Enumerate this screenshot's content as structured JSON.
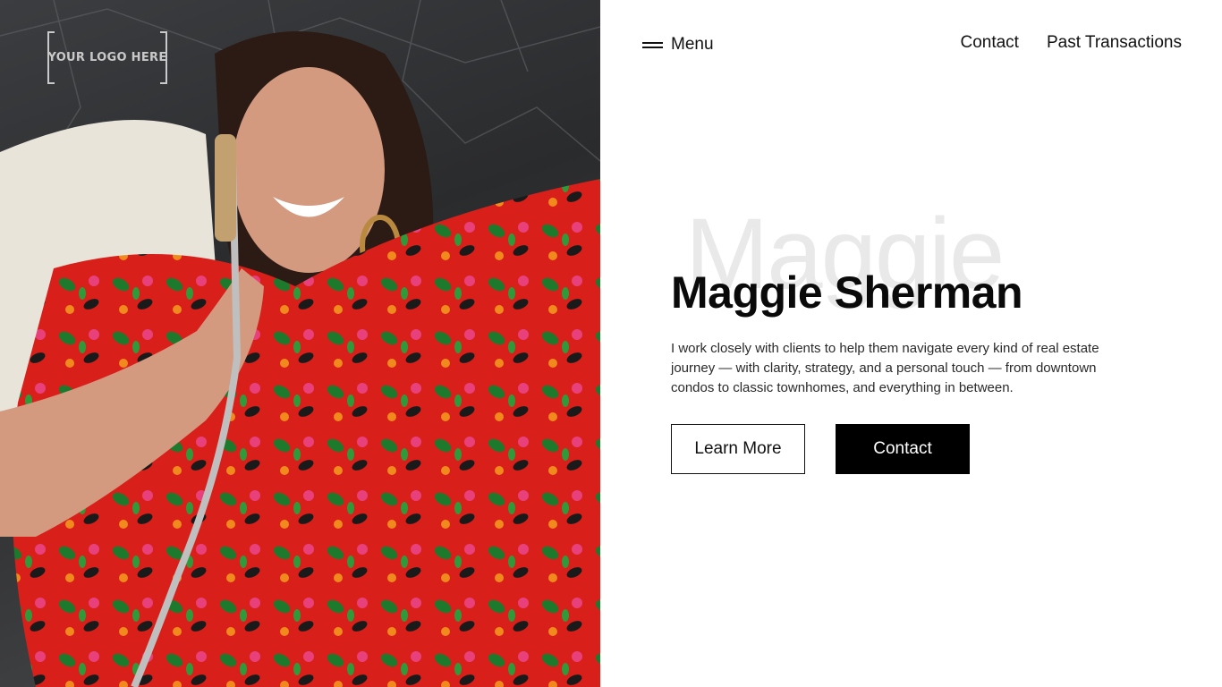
{
  "logo": {
    "text": "YOUR LOGO HERE"
  },
  "header": {
    "menu_label": "Menu",
    "nav": [
      "Contact",
      "Past Transactions"
    ]
  },
  "hero": {
    "ghost_text": "Maggie",
    "name": "Maggie Sherman",
    "description": "I work closely with clients to help them navigate every kind of real estate journey — with clarity, strategy, and a personal touch — from downtown condos to classic townhomes, and everything in between.",
    "learn_more_label": "Learn More",
    "contact_label": "Contact"
  },
  "colors": {
    "primary_button_bg": "#000000",
    "text": "#111111",
    "ghost_text": "#e9e9e9"
  }
}
